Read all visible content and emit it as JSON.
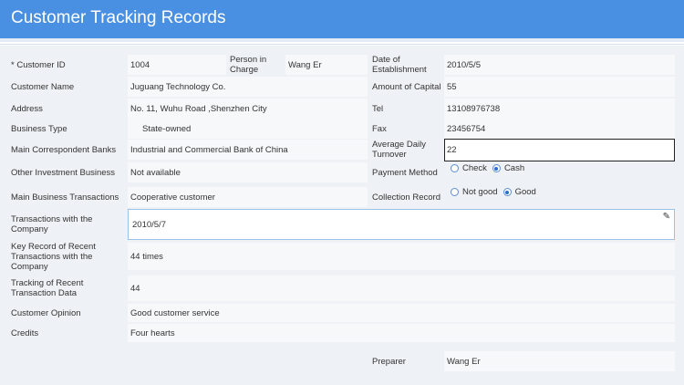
{
  "header": {
    "title": "Customer Tracking Records"
  },
  "labels": {
    "customer_id": "* Customer ID",
    "person_in_charge": "Person in Charge",
    "date_of_establishment": "Date of Establishment",
    "customer_name": "Customer Name",
    "amount_of_capital": "Amount of Capital",
    "address": "Address",
    "tel": "Tel",
    "business_type": "Business Type",
    "fax": "Fax",
    "main_correspondent_banks": "Main Correspondent Banks",
    "average_daily_turnover": "Average Daily Turnover",
    "other_investment_business": "Other Investment Business",
    "payment_method": "Payment Method",
    "main_business_transactions": "Main Business Transactions",
    "collection_record": "Collection Record",
    "transactions_with_company": "Transactions with the Company",
    "key_record_recent_transactions": "Key Record of Recent Transactions with the Company",
    "tracking_recent_transaction_data": "Tracking of Recent Transaction Data",
    "customer_opinion": "Customer Opinion",
    "credits": "Credits",
    "preparer": "Preparer"
  },
  "values": {
    "customer_id": "1004",
    "person_in_charge": "Wang Er",
    "date_of_establishment": "2010/5/5",
    "customer_name": "Juguang Technology Co.",
    "amount_of_capital": "55",
    "address": "No. 11, Wuhu Road ,Shenzhen City",
    "tel": "13108976738",
    "business_type": "State-owned",
    "fax": "23456754",
    "main_correspondent_banks": "Industrial and Commercial Bank of China",
    "average_daily_turnover": "22",
    "other_investment_business": "Not available",
    "main_business_transactions": "Cooperative customer",
    "transactions_with_company": "2010/5/7",
    "key_record_recent_transactions": "44 times",
    "tracking_recent_transaction_data": "44",
    "customer_opinion": "Good customer service",
    "credits": "Four hearts",
    "preparer": "Wang Er"
  },
  "payment_method": {
    "options": [
      "Check",
      "Cash"
    ],
    "selected": "Cash"
  },
  "collection_record": {
    "options": [
      "Not good",
      "Good"
    ],
    "selected": "Good"
  }
}
